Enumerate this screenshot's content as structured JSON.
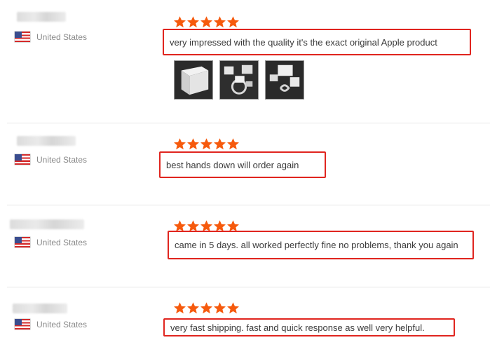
{
  "reviews": [
    {
      "country": "United States",
      "rating": 5,
      "text": "very impressed with the quality it's the exact original Apple product",
      "photos": [
        "product-photo-box",
        "product-photo-accessories",
        "product-photo-cable"
      ]
    },
    {
      "country": "United States",
      "rating": 5,
      "text": "best hands down will order again"
    },
    {
      "country": "United States",
      "rating": 5,
      "text": "came in 5 days. all worked perfectly fine no problems, thank you again"
    },
    {
      "country": "United States",
      "rating": 5,
      "text": "very fast shipping. fast and quick response as well very helpful."
    }
  ],
  "colors": {
    "star": "#f65a0d",
    "highlight_border": "#e0251f"
  },
  "icons": {
    "star": "star-icon",
    "flag": "us-flag-icon"
  }
}
